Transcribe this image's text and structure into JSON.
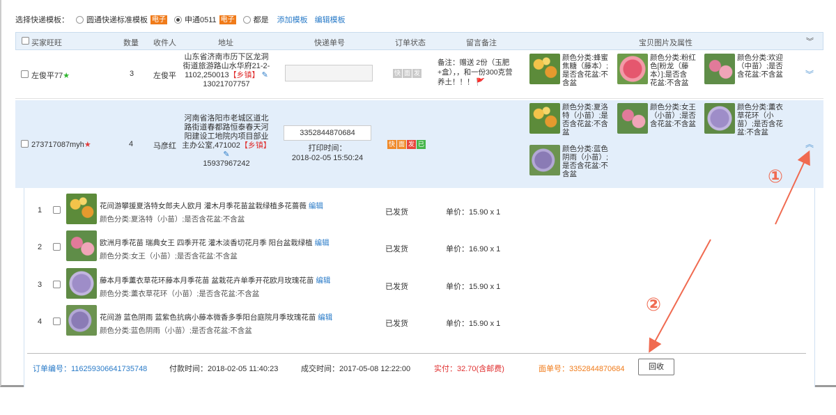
{
  "template_bar": {
    "label": "选择快递模板：",
    "options": [
      {
        "label": "圆通快递标准模板",
        "tag": "电子",
        "selected": false
      },
      {
        "label": "申通0511",
        "tag": "电子",
        "selected": true
      },
      {
        "label": "都是",
        "tag": "",
        "selected": false
      }
    ],
    "add_link": "添加模板",
    "edit_link": "编辑模板"
  },
  "table_header": {
    "buyer": "买家旺旺",
    "qty": "数量",
    "recipient": "收件人",
    "address": "地址",
    "tracking": "快递单号",
    "status": "订单状态",
    "note": "留言备注",
    "items": "宝贝图片及属性"
  },
  "orders": [
    {
      "buyer": "左俊平77",
      "buyer_star": "★",
      "star_color": "#2db52d",
      "qty": "3",
      "recipient": "左俊平",
      "address_lines": [
        "山东省济南市历下区龙洞",
        "街道旅游路山水华府21-2-",
        "1102,250013"
      ],
      "town_tag": "【乡镇】",
      "phone": "13021707757",
      "tracking": "",
      "status_icons": [
        "快",
        "面",
        "发"
      ],
      "note_lines": [
        "备注：赠送 2份（玉肥",
        "+盒），，和一份300克营",
        "养土！！！"
      ],
      "props": [
        {
          "lines": [
            "颜色分类:蜂蜜",
            "焦糖（藤本）;",
            "是否含花盆:不",
            "含盆"
          ]
        },
        {
          "lines": [
            "颜色分类:粉红",
            "色[粉龙（藤",
            "本）];是否含",
            "花盆:不含盆"
          ]
        },
        {
          "lines": [
            "颜色分类:欢迎",
            "（中苗）;是否",
            "含花盆:不含盆"
          ]
        }
      ]
    },
    {
      "buyer": "273717087myh",
      "buyer_star": "★",
      "star_color": "#e23b3b",
      "qty": "4",
      "recipient": "马彦红",
      "address_lines": [
        "河南省洛阳市老城区道北",
        "路街道春都路恒泰春天河",
        "阳建设工地院内项目部业",
        "主办公室,471002"
      ],
      "town_tag": "【乡镇】",
      "phone": "15937967242",
      "tracking": "3352844870684",
      "print_label": "打印时间：",
      "print_time": "2018-02-05 15:50:24",
      "status_icons": [
        "快",
        "面",
        "发",
        "已"
      ],
      "props": [
        {
          "lines": [
            "颜色分类:夏洛",
            "特（小苗）;是",
            "否含花盆:不含",
            "盆"
          ]
        },
        {
          "lines": [
            "颜色分类:女王",
            "（小苗）;是否",
            "含花盆:不含盆"
          ]
        },
        {
          "lines": [
            "颜色分类:薰衣",
            "草花环（小",
            "苗）;是否含花",
            "盆:不含盆"
          ]
        },
        {
          "lines": [
            "颜色分类:蓝色",
            "阴雨（小苗）;",
            "是否含花盆:不",
            "含盆"
          ]
        }
      ]
    }
  ],
  "items": [
    {
      "idx": "1",
      "title": "花间游攀援夏洛特女郎夫人欧月 灌木月季花苗盆栽绿植多花蔷薇",
      "edit": "编辑",
      "sub": "颜色分类:夏洛特（小苗）;是否含花盆:不含盆",
      "status": "已发货",
      "price": "单价：15.90 x  1"
    },
    {
      "idx": "2",
      "title": "欧洲月季花苗 瑞典女王 四季开花 灌木淡香切花月季 阳台盆栽绿植",
      "edit": "编辑",
      "sub": "颜色分类:女王（小苗）;是否含花盆:不含盆",
      "status": "已发货",
      "price": "单价：16.90 x  1"
    },
    {
      "idx": "3",
      "title": "藤本月季薰衣草花环藤本月季花苗 盆栽花卉单季开花欧月玫瑰花苗",
      "edit": "编辑",
      "sub": "颜色分类:薰衣草花环（小苗）;是否含花盆:不含盆",
      "status": "已发货",
      "price": "单价：15.90 x  1"
    },
    {
      "idx": "4",
      "title": "花间游 蓝色阴雨 蓝紫色抗病小藤本微香多季阳台庭院月季玫瑰花苗",
      "edit": "编辑",
      "sub": "颜色分类:蓝色阴雨（小苗）;是否含花盆:不含盆",
      "status": "已发货",
      "price": "单价：15.90 x  1"
    }
  ],
  "footer": {
    "order_no": "订单编号：116259306641735748",
    "pay_time": "付款时间：2018-02-05 11:40:23",
    "deal_time": "成交时间：2017-05-08 12:22:00",
    "paid": "实付：32.70(含邮费)",
    "face_no": "面单号：3352844870684",
    "recycle": "回收"
  },
  "annotations": {
    "one": "①",
    "two": "②"
  },
  "colors": {
    "accent": "#2a7bc8",
    "orange": "#f07b1a",
    "red": "#e03030",
    "arrow": "#f06a50",
    "highlight_row": "#e3eefa"
  }
}
